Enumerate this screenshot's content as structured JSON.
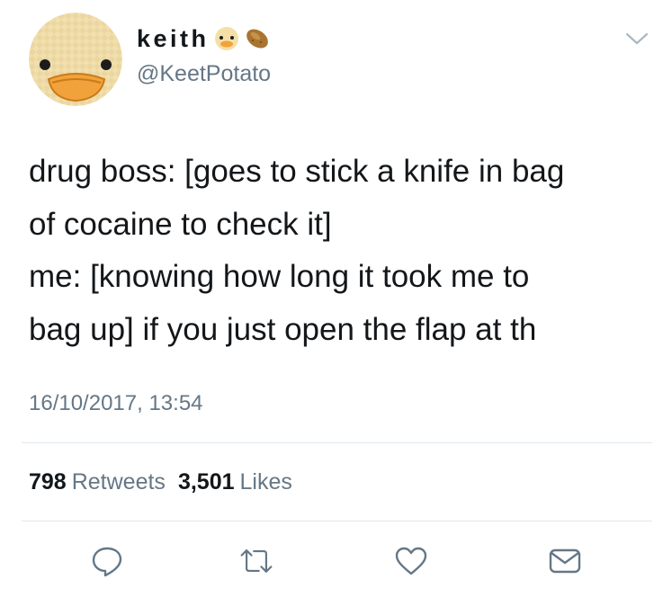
{
  "user": {
    "display_name": "keith",
    "handle": "@KeetPotato",
    "avatar_icon": "duck-face-avatar",
    "name_emojis": [
      "duck-emoji",
      "potato-emoji"
    ]
  },
  "tweet": {
    "lines": [
      "drug boss: [goes to stick a knife in bag",
      "of cocaine to check it]",
      "me: [knowing how long it took me to",
      "bag up] if you just open the flap at th"
    ],
    "timestamp": "16/10/2017, 13:54"
  },
  "stats": {
    "retweets_count": "798",
    "retweets_label": "Retweets",
    "likes_count": "3,501",
    "likes_label": "Likes"
  },
  "actions": [
    "reply-icon",
    "retweet-icon",
    "like-icon",
    "direct-message-icon"
  ],
  "colors": {
    "text": "#14171a",
    "secondary": "#657786",
    "divider": "#e1e8ed",
    "icon": "#657786"
  }
}
